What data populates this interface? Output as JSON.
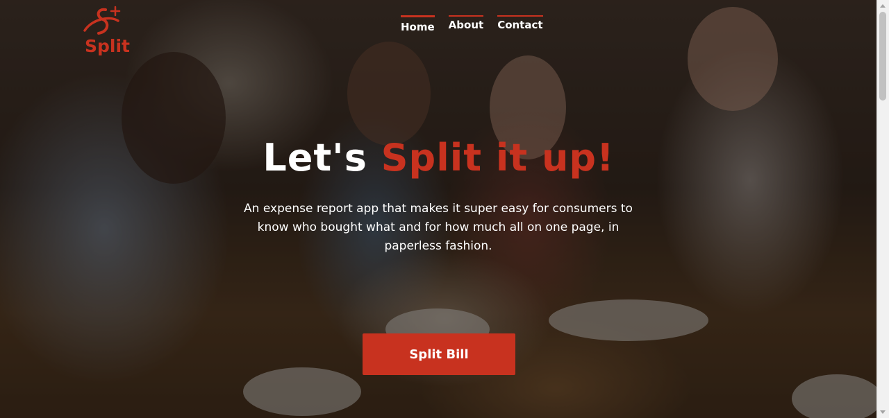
{
  "brand": {
    "name": "Split",
    "accent_color": "#c8321f",
    "logo_icon": "split-s-plus-logo-icon"
  },
  "nav": {
    "items": [
      {
        "label": "Home",
        "active": true
      },
      {
        "label": "About",
        "active": false
      },
      {
        "label": "Contact",
        "active": false
      }
    ]
  },
  "hero": {
    "headline_white": "Let's",
    "headline_red": "Split it up!",
    "subtitle": "An expense report app that makes it super easy for consumers to know who bought what and for how much all on one page, in paperless fashion.",
    "cta_label": "Split Bill"
  }
}
